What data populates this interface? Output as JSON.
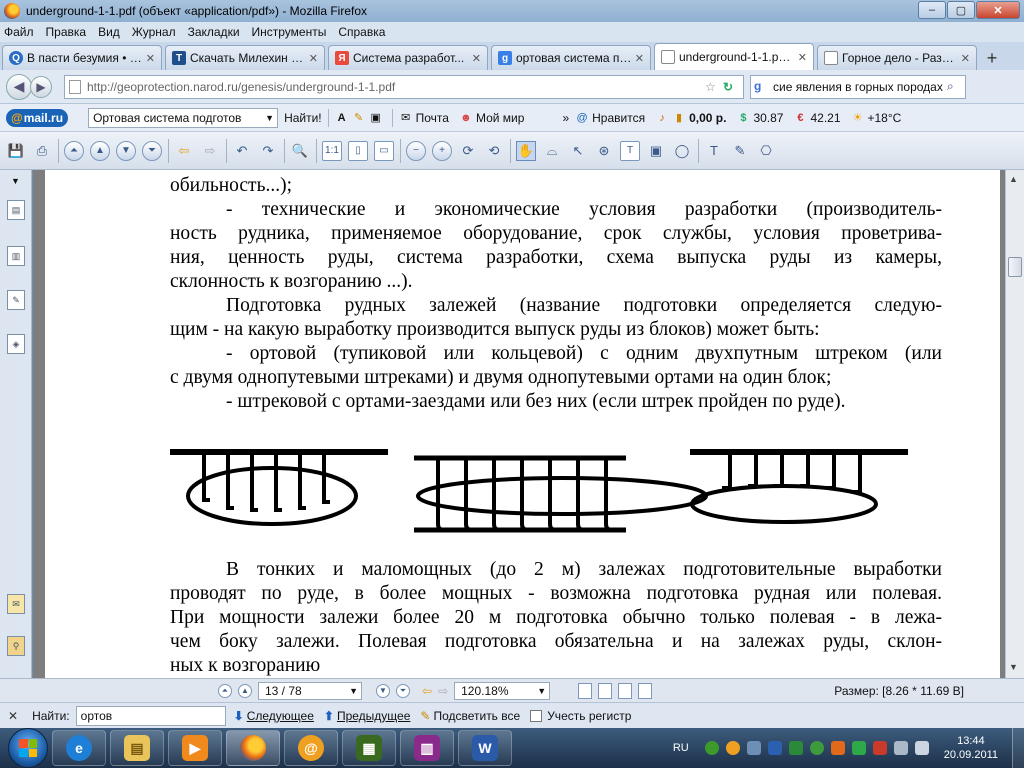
{
  "window": {
    "title": "underground-1-1.pdf (объект «application/pdf») - Mozilla Firefox",
    "controls": {
      "minimize": "–",
      "maximize": "▢",
      "close": "✕"
    }
  },
  "menu": [
    "Файл",
    "Правка",
    "Вид",
    "Журнал",
    "Закладки",
    "Инструменты",
    "Справка"
  ],
  "tabs": [
    {
      "label": "В пасти безумия • Si...",
      "icon": "circle-q-icon",
      "color": "#2b6cc4",
      "active": false
    },
    {
      "label": "Скачать Милехин Г....",
      "icon": "t-icon",
      "color": "#1f4f8a",
      "active": false
    },
    {
      "label": "Система разработ...",
      "icon": "yandex-icon",
      "color": "#e84a3c",
      "active": false
    },
    {
      "label": "ортовая система по...",
      "icon": "google-icon",
      "color": "#3a7ee8",
      "active": false
    },
    {
      "label": "underground-1-1.pd...",
      "icon": "page-icon",
      "color": "#888888",
      "active": true
    },
    {
      "label": "Горное дело - Разр...",
      "icon": "page-icon",
      "color": "#888888",
      "active": false
    }
  ],
  "nav": {
    "url": "http://geoprotection.narod.ru/genesis/underground-1-1.pdf",
    "search_value": "сие явления в горных породах"
  },
  "mailbar": {
    "logo_at": "@",
    "logo_text": "mail.ru",
    "search_select": "Ортовая система подготов",
    "find_button": "Найти!",
    "mail": "Почта",
    "myworld": "Мой мир",
    "more": "»",
    "like": "Нравится",
    "money": "0,00 р.",
    "usd": "30.87",
    "eur": "42.21",
    "weather": "+18°С"
  },
  "document": {
    "lines": [
      {
        "text": "обильность...);",
        "indent": false,
        "last": true
      },
      {
        "text": "- технические и экономические условия разработки (производитель-",
        "indent": true,
        "last": false
      },
      {
        "text": "ность рудника, применяемое оборудование, срок службы, условия проветрива-",
        "indent": false,
        "last": false
      },
      {
        "text": "ния, ценность руды, система разработки, схема выпуска руды из камеры,",
        "indent": false,
        "last": false
      },
      {
        "text": "склонность к возгоранию ...).",
        "indent": false,
        "last": true
      },
      {
        "text": "Подготовка рудных залежей (название подготовки определяется следую-",
        "indent": true,
        "last": false
      },
      {
        "text": "щим - на какую выработку производится выпуск руды из блоков) может быть:",
        "indent": false,
        "last": true
      },
      {
        "text": "- ортовой (тупиковой или кольцевой) с одним двухпутным штреком (или",
        "indent": true,
        "last": false
      },
      {
        "text": "с двумя однопутевыми штреками) и двумя однопутевыми ортами на один блок;",
        "indent": false,
        "last": true
      },
      {
        "text": "- штрековой с ортами-заездами или без них (если штрек пройден по руде).",
        "indent": true,
        "last": true
      }
    ],
    "lines2": [
      {
        "text": "В тонких и маломощных (до 2 м) залежах подготовительные выработки",
        "indent": true,
        "last": false
      },
      {
        "text": "проводят по руде, в более мощных - возможна подготовка рудная или полевая.",
        "indent": false,
        "last": false
      },
      {
        "text": "При мощности залежи более 20 м подготовка обычно только полевая - в лежа-",
        "indent": false,
        "last": false
      },
      {
        "text": "чем боку залежи. Полевая подготовка обязательна и на залежах руды, склон-",
        "indent": false,
        "last": false
      },
      {
        "text": "ных к возгоранию",
        "indent": false,
        "last": true
      }
    ]
  },
  "pdfstatus": {
    "page": "13 / 78",
    "zoom": "120.18%",
    "size": "Размер: [8.26 * 11.69 B]"
  },
  "findbar": {
    "label": "Найти:",
    "value": "ортов",
    "next": "Следующее",
    "prev": "Предыдущее",
    "highlight": "Подсветить все",
    "matchcase": "Учесть регистр"
  },
  "taskbar": {
    "apps": [
      {
        "icon": "ie-icon",
        "color": "#1f7fd6",
        "glyph": "e"
      },
      {
        "icon": "explorer-icon",
        "color": "#e8c45a",
        "glyph": "▤"
      },
      {
        "icon": "media-player-icon",
        "color": "#f08a1c",
        "glyph": "▶"
      },
      {
        "icon": "firefox-icon",
        "color": "#e86a14",
        "glyph": "●"
      },
      {
        "icon": "mail-agent-icon",
        "color": "#f0a020",
        "glyph": "@"
      },
      {
        "icon": "video-icon",
        "color": "#3a6a20",
        "glyph": "▦"
      },
      {
        "icon": "winrar-icon",
        "color": "#8a2a8a",
        "glyph": "▥"
      },
      {
        "icon": "word-icon",
        "color": "#2a5aa8",
        "glyph": "W"
      }
    ],
    "lang": "RU",
    "time": "13:44",
    "date": "20.09.2011"
  }
}
